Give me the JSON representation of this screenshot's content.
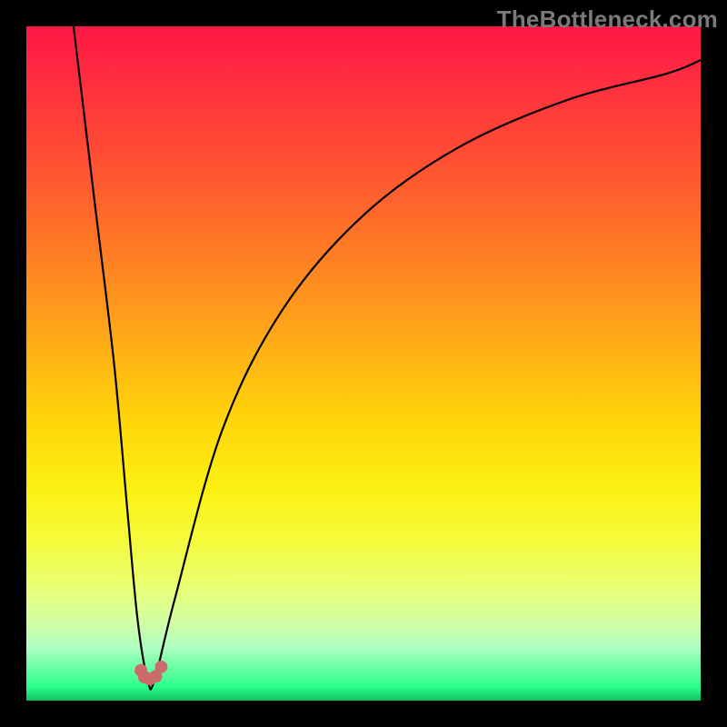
{
  "watermark": "TheBottleneck.com",
  "chart_data": {
    "type": "line",
    "title": "",
    "xlabel": "",
    "ylabel": "",
    "xlim": [
      0,
      100
    ],
    "ylim": [
      0,
      100
    ],
    "grid": false,
    "legend": false,
    "series": [
      {
        "name": "curve",
        "color": "#000000",
        "x_min_percent": 18,
        "curve_points_percent_xy": [
          [
            7,
            100
          ],
          [
            10,
            75
          ],
          [
            13,
            50
          ],
          [
            15,
            28
          ],
          [
            16.5,
            12
          ],
          [
            18,
            3
          ],
          [
            19,
            3
          ],
          [
            22,
            15
          ],
          [
            29,
            40
          ],
          [
            38,
            58
          ],
          [
            50,
            72
          ],
          [
            64,
            82
          ],
          [
            80,
            89
          ],
          [
            95,
            93
          ],
          [
            100,
            95
          ]
        ],
        "minimum_markers_percent_xy": [
          [
            17.0,
            4.5
          ],
          [
            17.5,
            3.5
          ],
          [
            18.3,
            3.2
          ],
          [
            19.2,
            3.6
          ],
          [
            20.0,
            5.0
          ]
        ],
        "marker_color": "#cc6b6b"
      }
    ]
  }
}
